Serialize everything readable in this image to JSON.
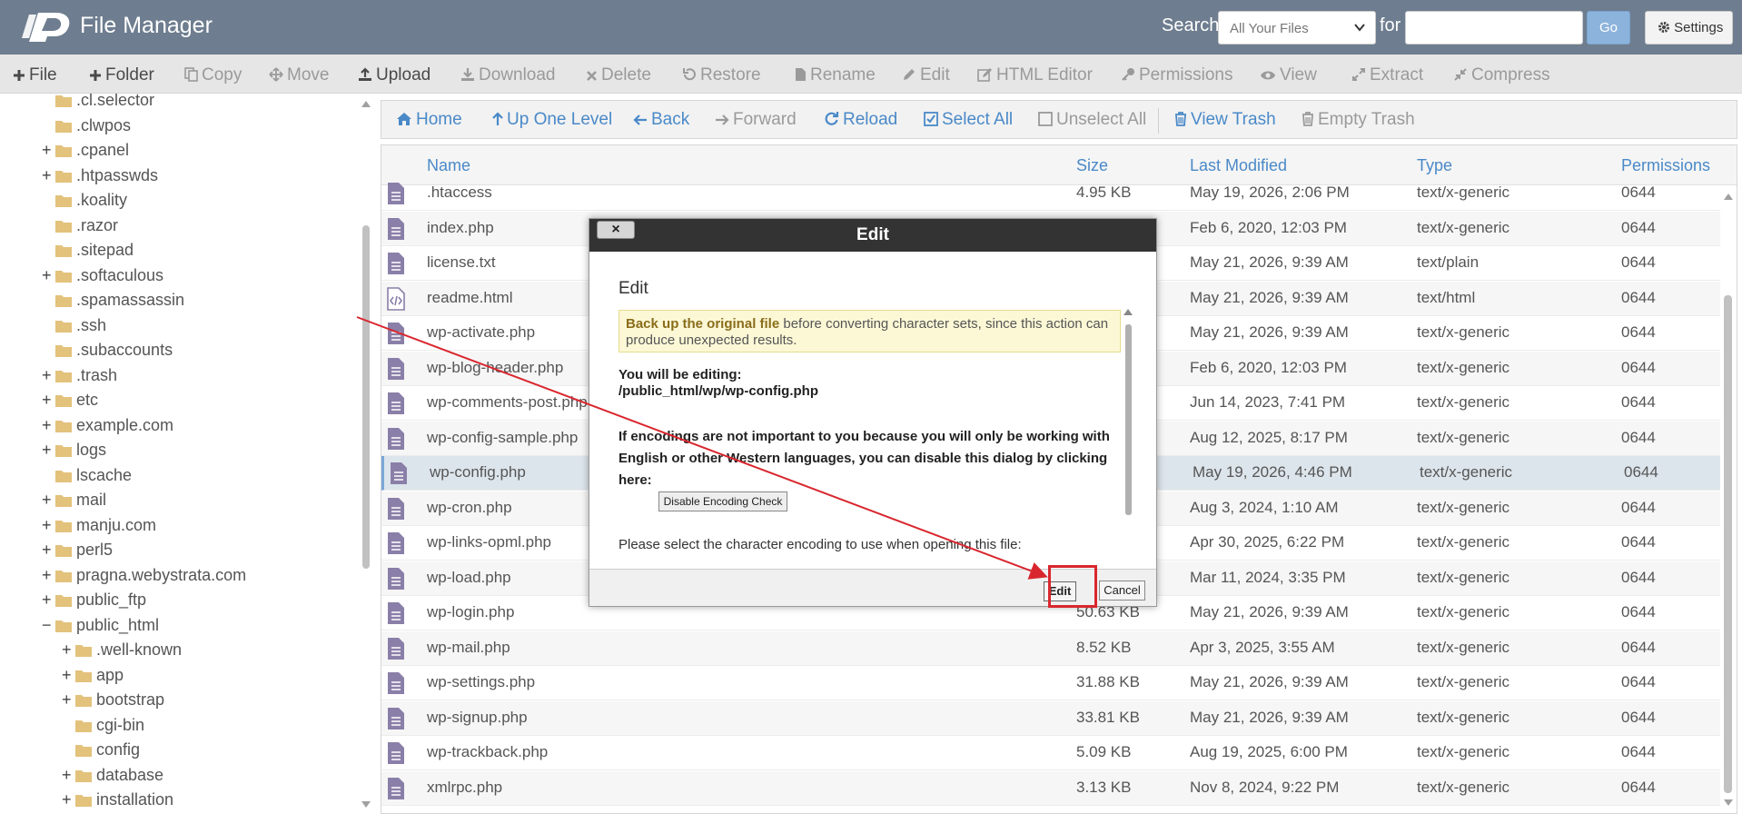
{
  "header": {
    "title": "File Manager",
    "search_label": "Search",
    "search_scope": "All Your Files",
    "for_label": "for",
    "search_value": "",
    "go_label": "Go",
    "settings_label": "Settings"
  },
  "toolbar": {
    "file": "File",
    "folder": "Folder",
    "copy": "Copy",
    "move": "Move",
    "upload": "Upload",
    "download": "Download",
    "delete": "Delete",
    "restore": "Restore",
    "rename": "Rename",
    "edit": "Edit",
    "html_editor": "HTML Editor",
    "permissions": "Permissions",
    "view": "View",
    "extract": "Extract",
    "compress": "Compress"
  },
  "navbar": {
    "home": "Home",
    "up_one_level": "Up One Level",
    "back": "Back",
    "forward": "Forward",
    "reload": "Reload",
    "select_all": "Select All",
    "unselect_all": "Unselect All",
    "view_trash": "View Trash",
    "empty_trash": "Empty Trash"
  },
  "tree": [
    {
      "label": ".cl.selector",
      "expandable": false
    },
    {
      "label": ".clwpos",
      "expandable": false
    },
    {
      "label": ".cpanel",
      "expandable": true
    },
    {
      "label": ".htpasswds",
      "expandable": true
    },
    {
      "label": ".koality",
      "expandable": false
    },
    {
      "label": ".razor",
      "expandable": false
    },
    {
      "label": ".sitepad",
      "expandable": false
    },
    {
      "label": ".softaculous",
      "expandable": true
    },
    {
      "label": ".spamassassin",
      "expandable": false
    },
    {
      "label": ".ssh",
      "expandable": false
    },
    {
      "label": ".subaccounts",
      "expandable": false
    },
    {
      "label": ".trash",
      "expandable": true
    },
    {
      "label": "etc",
      "expandable": true
    },
    {
      "label": "example.com",
      "expandable": true
    },
    {
      "label": "logs",
      "expandable": true
    },
    {
      "label": "lscache",
      "expandable": false
    },
    {
      "label": "mail",
      "expandable": true
    },
    {
      "label": "manju.com",
      "expandable": true
    },
    {
      "label": "perl5",
      "expandable": true
    },
    {
      "label": "pragna.webystrata.com",
      "expandable": true
    },
    {
      "label": "public_ftp",
      "expandable": true
    },
    {
      "label": "public_html",
      "expandable": true,
      "expanded": true
    },
    {
      "label": ".well-known",
      "expandable": true,
      "child": true
    },
    {
      "label": "app",
      "expandable": true,
      "child": true
    },
    {
      "label": "bootstrap",
      "expandable": true,
      "child": true
    },
    {
      "label": "cgi-bin",
      "expandable": false,
      "child": true
    },
    {
      "label": "config",
      "expandable": false,
      "child": true
    },
    {
      "label": "database",
      "expandable": true,
      "child": true
    },
    {
      "label": "installation",
      "expandable": true,
      "child": true
    }
  ],
  "table": {
    "columns": [
      "Name",
      "Size",
      "Last Modified",
      "Type",
      "Permissions"
    ],
    "rows": [
      {
        "name": ".htaccess",
        "size": "4.95 KB",
        "modified": "May 19, 2026, 2:06 PM",
        "type": "text/x-generic",
        "perm": "0644",
        "icon": "doc"
      },
      {
        "name": "index.php",
        "size": "",
        "modified": "Feb 6, 2020, 12:03 PM",
        "type": "text/x-generic",
        "perm": "0644",
        "icon": "doc"
      },
      {
        "name": "license.txt",
        "size": "",
        "modified": "May 21, 2026, 9:39 AM",
        "type": "text/plain",
        "perm": "0644",
        "icon": "doc"
      },
      {
        "name": "readme.html",
        "size": "",
        "modified": "May 21, 2026, 9:39 AM",
        "type": "text/html",
        "perm": "0644",
        "icon": "code"
      },
      {
        "name": "wp-activate.php",
        "size": "",
        "modified": "May 21, 2026, 9:39 AM",
        "type": "text/x-generic",
        "perm": "0644",
        "icon": "doc"
      },
      {
        "name": "wp-blog-header.php",
        "size": "",
        "modified": "Feb 6, 2020, 12:03 PM",
        "type": "text/x-generic",
        "perm": "0644",
        "icon": "doc"
      },
      {
        "name": "wp-comments-post.php",
        "size": "",
        "modified": "Jun 14, 2023, 7:41 PM",
        "type": "text/x-generic",
        "perm": "0644",
        "icon": "doc"
      },
      {
        "name": "wp-config-sample.php",
        "size": "",
        "modified": "Aug 12, 2025, 8:17 PM",
        "type": "text/x-generic",
        "perm": "0644",
        "icon": "doc"
      },
      {
        "name": "wp-config.php",
        "size": "",
        "modified": "May 19, 2026, 4:46 PM",
        "type": "text/x-generic",
        "perm": "0644",
        "icon": "doc",
        "selected": true
      },
      {
        "name": "wp-cron.php",
        "size": "",
        "modified": "Aug 3, 2024, 1:10 AM",
        "type": "text/x-generic",
        "perm": "0644",
        "icon": "doc"
      },
      {
        "name": "wp-links-opml.php",
        "size": "",
        "modified": "Apr 30, 2025, 6:22 PM",
        "type": "text/x-generic",
        "perm": "0644",
        "icon": "doc"
      },
      {
        "name": "wp-load.php",
        "size": "",
        "modified": "Mar 11, 2024, 3:35 PM",
        "type": "text/x-generic",
        "perm": "0644",
        "icon": "doc"
      },
      {
        "name": "wp-login.php",
        "size": "50.63 KB",
        "modified": "May 21, 2026, 9:39 AM",
        "type": "text/x-generic",
        "perm": "0644",
        "icon": "doc"
      },
      {
        "name": "wp-mail.php",
        "size": "8.52 KB",
        "modified": "Apr 3, 2025, 3:55 AM",
        "type": "text/x-generic",
        "perm": "0644",
        "icon": "doc"
      },
      {
        "name": "wp-settings.php",
        "size": "31.88 KB",
        "modified": "May 21, 2026, 9:39 AM",
        "type": "text/x-generic",
        "perm": "0644",
        "icon": "doc"
      },
      {
        "name": "wp-signup.php",
        "size": "33.81 KB",
        "modified": "May 21, 2026, 9:39 AM",
        "type": "text/x-generic",
        "perm": "0644",
        "icon": "doc"
      },
      {
        "name": "wp-trackback.php",
        "size": "5.09 KB",
        "modified": "Aug 19, 2025, 6:00 PM",
        "type": "text/x-generic",
        "perm": "0644",
        "icon": "doc"
      },
      {
        "name": "xmlrpc.php",
        "size": "3.13 KB",
        "modified": "Nov 8, 2024, 9:22 PM",
        "type": "text/x-generic",
        "perm": "0644",
        "icon": "doc"
      }
    ]
  },
  "modal": {
    "close": "×",
    "title": "Edit",
    "heading": "Edit",
    "warn_bold": "Back up the original file",
    "warn_rest": " before converting character sets, since this action can produce unexpected results.",
    "editing_label": "You will be editing:",
    "editing_path": "/public_html/wp/wp-config.php",
    "encoding_note": "If encodings are not important to you because you will only be working with English or other Western languages, you can disable this dialog by clicking here:",
    "disable_button": "Disable Encoding Check",
    "select_note": "Please select the character encoding to use when opening this file:",
    "edit_button": "Edit",
    "cancel_button": "Cancel"
  },
  "colors": {
    "header_bg": "#6e7d8f",
    "link_blue": "#4a89c8",
    "annotation_red": "#d9262e",
    "folder": "#e3c27c"
  }
}
